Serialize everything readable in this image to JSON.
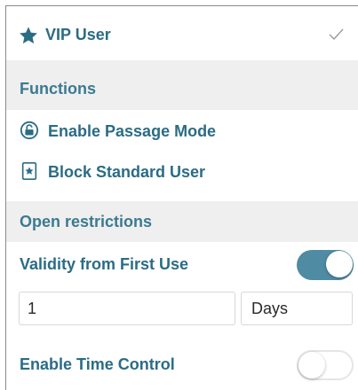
{
  "vip": {
    "label": "VIP User",
    "icon": "star-icon",
    "checked": true
  },
  "functions": {
    "header": "Functions",
    "items": [
      {
        "label": "Enable Passage Mode",
        "icon": "lock-circle-icon"
      },
      {
        "label": "Block Standard User",
        "icon": "star-badge-icon"
      }
    ]
  },
  "open_restrictions": {
    "header": "Open restrictions",
    "validity": {
      "label": "Validity from First Use",
      "enabled": true
    },
    "duration": {
      "value": "1",
      "unit": "Days"
    },
    "time_control": {
      "label": "Enable Time Control",
      "enabled": false
    }
  },
  "colors": {
    "accent": "#2b6c85",
    "toggle_on": "#4f8ba2",
    "section_bg": "#efefef"
  }
}
